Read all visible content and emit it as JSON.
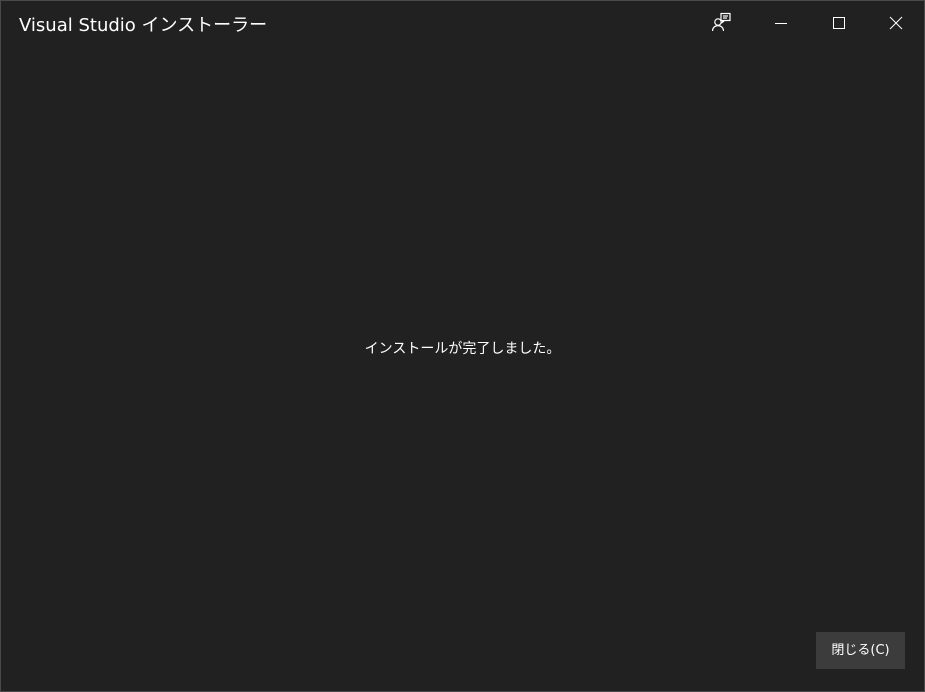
{
  "window": {
    "title": "Visual Studio インストーラー"
  },
  "titlebar_buttons": {
    "feedback_icon": "feedback-icon",
    "minimize_icon": "minimize-icon",
    "maximize_icon": "maximize-icon",
    "close_icon": "close-icon"
  },
  "main": {
    "message": "インストールが完了しました。"
  },
  "footer": {
    "close_label": "閉じる(C)"
  },
  "colors": {
    "background": "#212121",
    "button": "#3c3c3c",
    "text": "#ffffff"
  }
}
